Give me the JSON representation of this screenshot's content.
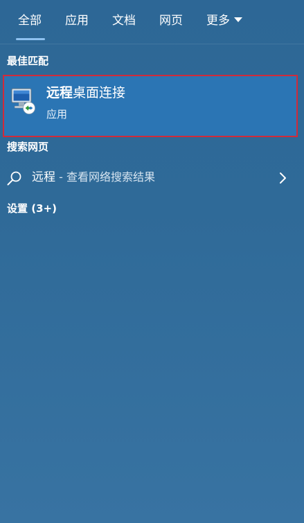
{
  "tabs": [
    {
      "label": "全部",
      "active": true
    },
    {
      "label": "应用"
    },
    {
      "label": "文档"
    },
    {
      "label": "网页"
    },
    {
      "label": "更多"
    }
  ],
  "best_match": {
    "section_title": "最佳匹配",
    "app_name_highlight": "远程",
    "app_name_rest": "桌面连接",
    "app_type": "应用",
    "icon": "remote-desktop-icon"
  },
  "web_search": {
    "section_title": "搜索网页",
    "term": "远程",
    "description": " - 查看网络搜索结果",
    "icon": "search-icon"
  },
  "settings": {
    "section_title": "设置 (3+)"
  },
  "colors": {
    "background": "#2f6a98",
    "selected_item": "#2b75b4",
    "highlight_border": "#d22a3a",
    "tab_underline": "#8fc2f0"
  }
}
